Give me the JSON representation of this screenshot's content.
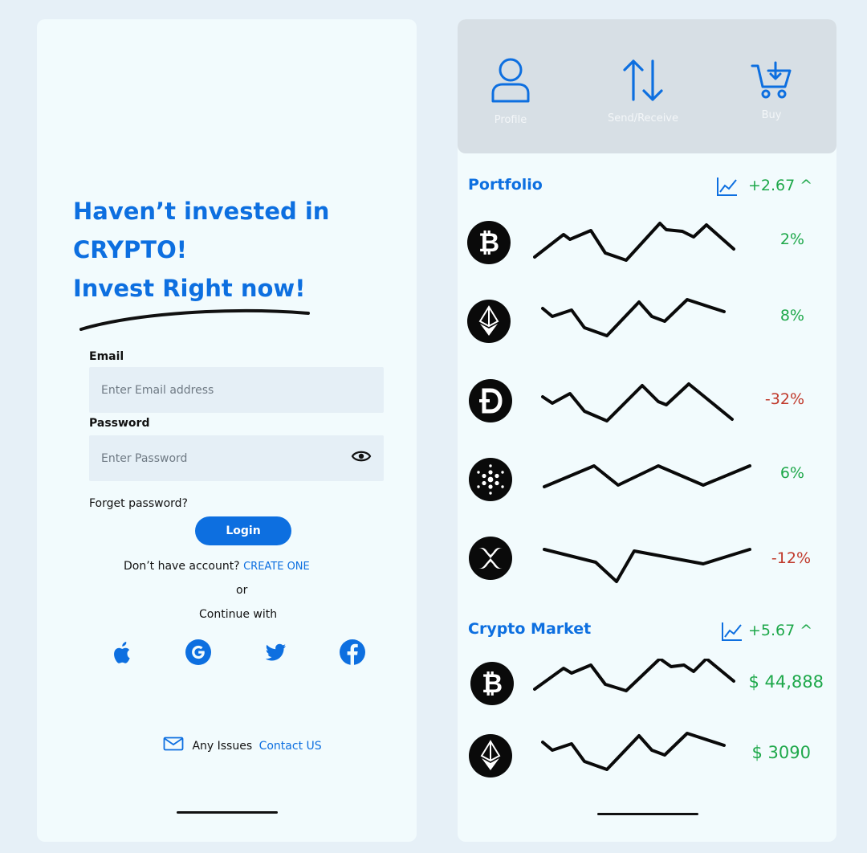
{
  "login": {
    "headline": [
      "Haven’t invested in",
      "CRYPTO!",
      "Invest Right now!"
    ],
    "email_label": "Email",
    "email_placeholder": "Enter Email address",
    "password_label": "Password",
    "password_placeholder": "Enter Password",
    "forgot": "Forget password?",
    "login_button": "Login",
    "no_account": "Don’t have account?",
    "create_one": "CREATE ONE",
    "or": "or",
    "continue_with": "Continue with",
    "social": [
      "apple-icon",
      "google-icon",
      "twitter-icon",
      "facebook-icon"
    ],
    "issues": "Any Issues",
    "contact": "Contact US"
  },
  "actions": [
    {
      "label": "Profile",
      "icon": "profile-icon"
    },
    {
      "label": "Send/Receive",
      "icon": "send-receive-icon"
    },
    {
      "label": "Buy",
      "icon": "cart-icon"
    }
  ],
  "portfolio": {
    "title": "Portfolio",
    "change": "+2.67 ^",
    "items": [
      {
        "coin": "bitcoin-icon",
        "value": "2%",
        "trend": "positive"
      },
      {
        "coin": "ethereum-icon",
        "value": "8%",
        "trend": "positive"
      },
      {
        "coin": "dash-icon",
        "value": "-32%",
        "trend": "negative"
      },
      {
        "coin": "cardano-icon",
        "value": "6%",
        "trend": "positive"
      },
      {
        "coin": "ripple-icon",
        "value": "-12%",
        "trend": "negative"
      }
    ]
  },
  "market": {
    "title": "Crypto Market",
    "change": "+5.67 ^",
    "items": [
      {
        "coin": "bitcoin-icon",
        "value": "$ 44,888",
        "trend": "positive"
      },
      {
        "coin": "ethereum-icon",
        "value": "$ 3090",
        "trend": "positive"
      }
    ]
  },
  "colors": {
    "accent": "#0d6fe0",
    "positive": "#1ea84a",
    "negative": "#c0392b",
    "card": "#f2fbfd",
    "background": "#e6f0f7"
  }
}
